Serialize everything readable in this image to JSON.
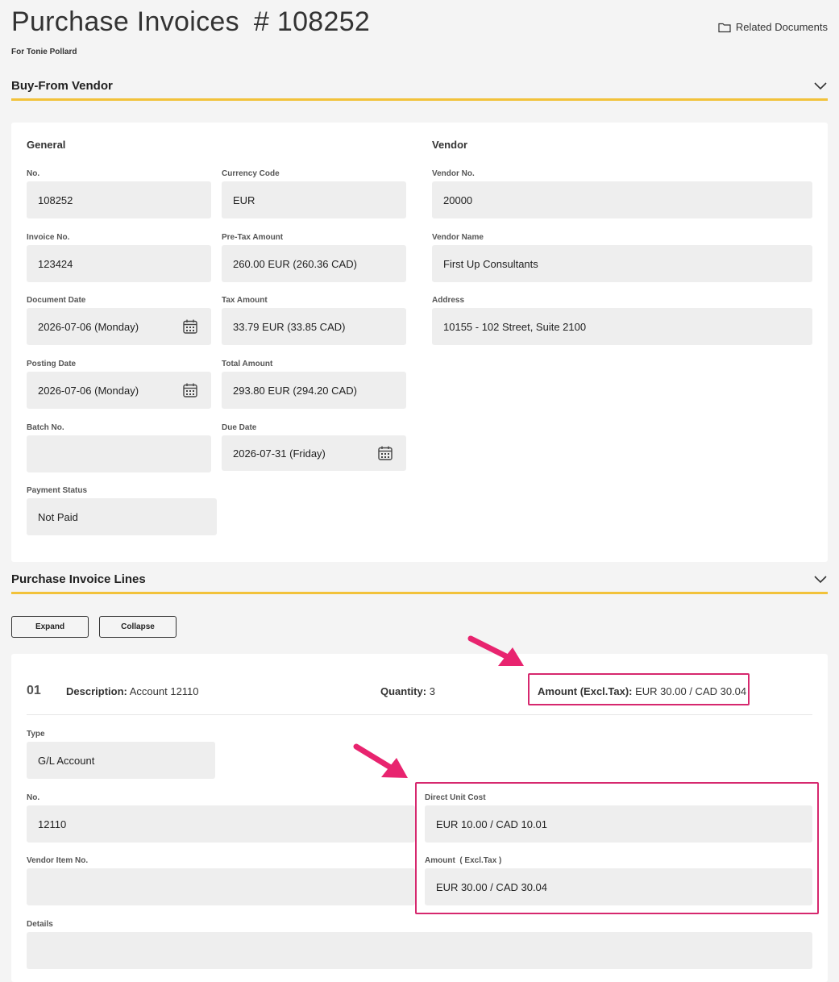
{
  "header": {
    "title": "Purchase Invoices",
    "number": "# 108252",
    "subtitle": "For Tonie Pollard",
    "related_documents": "Related Documents"
  },
  "buy_from_vendor": {
    "section_title": "Buy-From Vendor",
    "general_heading": "General",
    "vendor_heading": "Vendor",
    "fields": {
      "no": {
        "label": "No.",
        "value": "108252"
      },
      "currency_code": {
        "label": "Currency Code",
        "value": "EUR"
      },
      "invoice_no": {
        "label": "Invoice No.",
        "value": "123424"
      },
      "pre_tax_amount": {
        "label": "Pre-Tax Amount",
        "value": "260.00 EUR (260.36 CAD)"
      },
      "document_date": {
        "label": "Document Date",
        "value": "2026-07-06 (Monday)"
      },
      "tax_amount": {
        "label": "Tax Amount",
        "value": "33.79 EUR (33.85 CAD)"
      },
      "posting_date": {
        "label": "Posting Date",
        "value": "2026-07-06 (Monday)"
      },
      "total_amount": {
        "label": "Total Amount",
        "value": "293.80 EUR (294.20 CAD)"
      },
      "batch_no": {
        "label": "Batch No.",
        "value": ""
      },
      "due_date": {
        "label": "Due Date",
        "value": "2026-07-31 (Friday)"
      },
      "payment_status": {
        "label": "Payment Status",
        "value": "Not Paid"
      },
      "vendor_no": {
        "label": "Vendor No.",
        "value": "20000"
      },
      "vendor_name": {
        "label": "Vendor Name",
        "value": "First Up Consultants"
      },
      "address": {
        "label": "Address",
        "value": "10155 - 102 Street, Suite 2100"
      }
    }
  },
  "invoice_lines": {
    "section_title": "Purchase Invoice Lines",
    "expand_label": "Expand",
    "collapse_label": "Collapse",
    "line": {
      "line_no": "01",
      "description_label": "Description:",
      "description_value": "Account 12110",
      "quantity_label": "Quantity:",
      "quantity_value": "3",
      "amount_label": "Amount (Excl.Tax):",
      "amount_value": "EUR 30.00 / CAD 30.04",
      "fields": {
        "type": {
          "label": "Type",
          "value": "G/L Account"
        },
        "no": {
          "label": "No.",
          "value": "12110"
        },
        "direct_unit_cost": {
          "label": "Direct Unit Cost",
          "value": "EUR 10.00 / CAD 10.01"
        },
        "vendor_item_no": {
          "label": "Vendor Item No.",
          "value": ""
        },
        "amount_excl_tax": {
          "label": "Amount  ( Excl.Tax )",
          "value": "EUR 30.00 / CAD 30.04"
        },
        "details": {
          "label": "Details",
          "value": ""
        }
      }
    }
  },
  "colors": {
    "accent": "#f2c23a",
    "highlight": "#d6286e",
    "field_bg": "#eeeeee"
  }
}
